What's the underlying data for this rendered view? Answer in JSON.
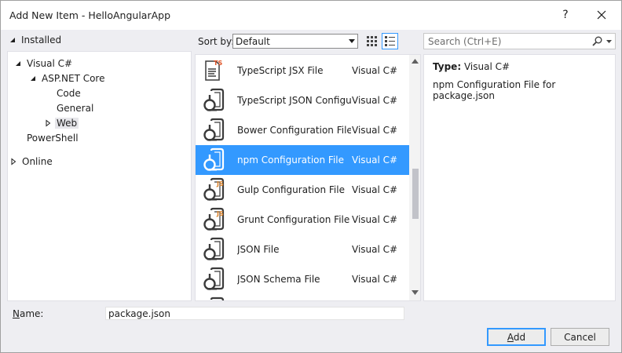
{
  "window": {
    "title": "Add New Item - HelloAngularApp",
    "help_label": "?",
    "close_icon": "close-icon"
  },
  "tree": {
    "installed": "Installed",
    "visual_csharp": "Visual C#",
    "aspnet_core": "ASP.NET Core",
    "code": "Code",
    "general": "General",
    "web": "Web",
    "powershell": "PowerShell",
    "online": "Online"
  },
  "toolbar": {
    "sort_label": "Sort by:",
    "sort_value": "Default",
    "search_placeholder": "Search (Ctrl+E)"
  },
  "items": [
    {
      "name": "TypeScript JSX File",
      "lang": "Visual C#",
      "icon": "typescript-file-icon",
      "badge": "TS",
      "selected": false
    },
    {
      "name": "TypeScript JSON Configur...",
      "lang": "Visual C#",
      "icon": "json-file-icon",
      "badge": "",
      "selected": false
    },
    {
      "name": "Bower Configuration File",
      "lang": "Visual C#",
      "icon": "json-file-icon",
      "badge": "",
      "selected": false
    },
    {
      "name": "npm Configuration File",
      "lang": "Visual C#",
      "icon": "json-file-icon",
      "badge": "",
      "selected": true
    },
    {
      "name": "Gulp Configuration File",
      "lang": "Visual C#",
      "icon": "js-config-file-icon",
      "badge": "JS",
      "selected": false
    },
    {
      "name": "Grunt Configuration File",
      "lang": "Visual C#",
      "icon": "js-config-file-icon",
      "badge": "JS",
      "selected": false
    },
    {
      "name": "JSON File",
      "lang": "Visual C#",
      "icon": "json-file-icon",
      "badge": "",
      "selected": false
    },
    {
      "name": "JSON Schema File",
      "lang": "Visual C#",
      "icon": "json-file-icon",
      "badge": "",
      "selected": false
    }
  ],
  "details": {
    "type_key": "Type:",
    "type_value": "Visual C#",
    "description": "npm Configuration File for package.json"
  },
  "bottom": {
    "name_label_first": "N",
    "name_label_rest": "ame:",
    "name_value": "package.json",
    "add_label_first": "A",
    "add_label_rest": "dd",
    "cancel_label": "Cancel"
  },
  "colors": {
    "selection": "#3399ff",
    "badge_ts": "#e0562a",
    "badge_js": "#e0852a",
    "icon_dark": "#3b3b3b"
  }
}
